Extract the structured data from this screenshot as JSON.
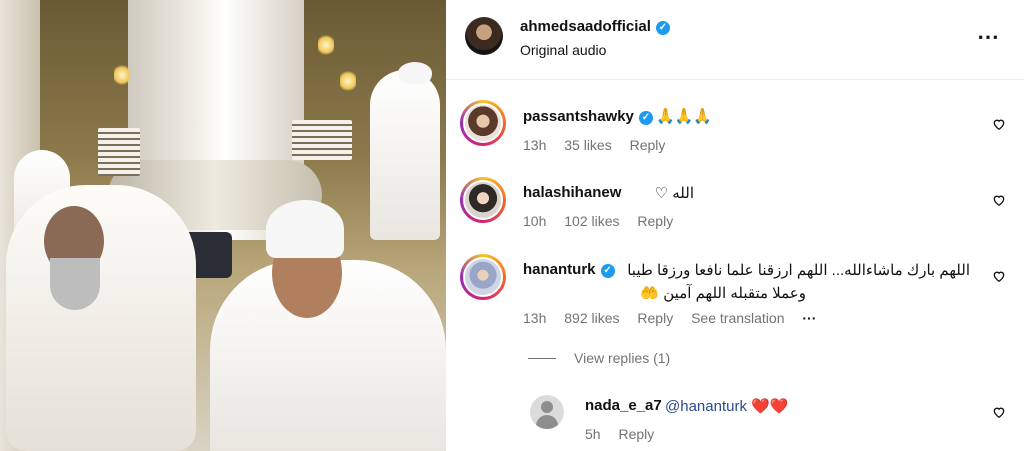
{
  "post": {
    "owner": {
      "username": "ahmedsaadofficial",
      "subtitle": "Original audio"
    },
    "more_icon": "⋯"
  },
  "comments": [
    {
      "username": "passantshawky",
      "text": "🙏🙏🙏",
      "time": "13h",
      "likes": "35 likes",
      "reply": "Reply"
    },
    {
      "username": "halashihanew",
      "text": "الله ♡",
      "time": "10h",
      "likes": "102 likes",
      "reply": "Reply"
    },
    {
      "username": "hananturk",
      "text_line1": "اللهم بارك ماشاءالله... اللهم ارزقنا علما نافعا ورزقا طيبا",
      "text_line2": "وعملا متقبله اللهم آمين 🤲",
      "time": "13h",
      "likes": "892 likes",
      "reply": "Reply",
      "translate": "See translation",
      "more": "···"
    }
  ],
  "view_replies": "View replies (1)",
  "reply": {
    "username": "nada_e_a7",
    "mention": "@hananturk",
    "hearts": "❤️❤️",
    "time": "5h",
    "reply": "Reply"
  },
  "icons": {
    "verified": "verified-badge-icon",
    "heart": "heart-outline-icon",
    "more": "more-horizontal-icon"
  },
  "colors": {
    "verified": "#1d9bf0",
    "secondary_text": "#737373",
    "mention": "#2b4a8b"
  }
}
